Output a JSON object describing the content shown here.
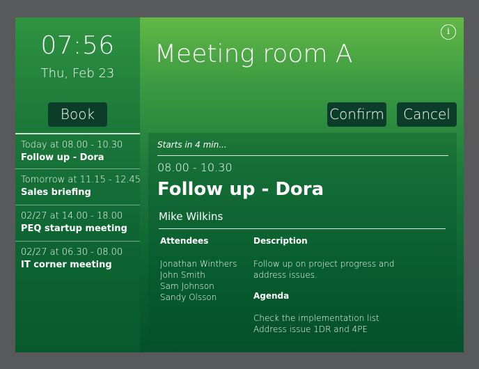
{
  "sidebar": {
    "time": "07:56",
    "date": "Thu, Feb 23",
    "book_label": "Book",
    "meetings": [
      {
        "time": "Today at 08.00 - 10.30",
        "title": "Follow up - Dora"
      },
      {
        "time": "Tomorrow at 11.15 - 12.45",
        "title": "Sales briefing"
      },
      {
        "time": "02/27 at 14.00 - 18.00",
        "title": "PEQ startup meeting"
      },
      {
        "time": "02/27 at 06.30 - 08.00",
        "title": "IT corner meeting"
      }
    ]
  },
  "header": {
    "room_name": "Meeting room A",
    "info_glyph": "i",
    "confirm_label": "Confirm",
    "cancel_label": "Cancel"
  },
  "detail": {
    "status": "Starts in 4 min...",
    "time_range": "08.00 - 10.30",
    "title": "Follow up - Dora",
    "organizer": "Mike Wilkins",
    "attendees_heading": "Attendees",
    "attendees": [
      "Jonathan Winthers",
      "John Smith",
      "Sam Johnson",
      "Sandy Olsson"
    ],
    "description_heading": "Description",
    "description": "Follow up on project progress and address issues.",
    "agenda_heading": "Agenda",
    "agenda": [
      "Check the implementation list",
      "Address issue 1DR and 4PE"
    ]
  },
  "icons": {
    "info": "info-icon"
  },
  "colors": {
    "frame": "#58595b",
    "button_bg": "#0b3d2a",
    "green_top": "#62b846",
    "green_bottom": "#054f2a"
  }
}
